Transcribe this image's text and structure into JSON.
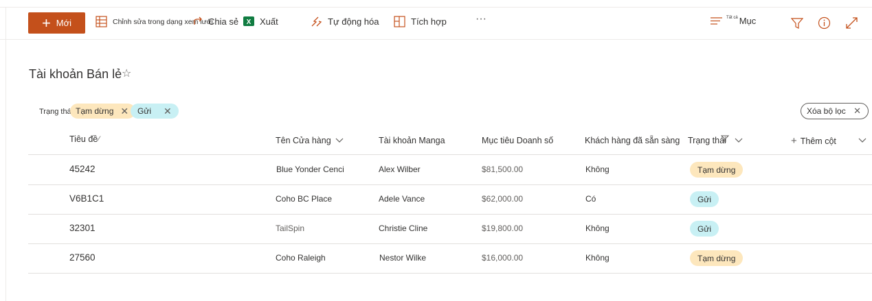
{
  "toolbar": {
    "new_label": "Mới",
    "edit_grid_label": "Chỉnh sửa trong dạng xem lưới",
    "share_label": "Chia sẻ",
    "export_label": "Xuất",
    "automate_label": "Tự động hóa",
    "integrate_label": "Tích hợp",
    "more_label": "···",
    "view_small": "Tất cả",
    "view_label": "Mục"
  },
  "page": {
    "title": "Tài khoản Bán lẻ"
  },
  "filters": {
    "label": "Trạng thái:",
    "pills": [
      {
        "label": "Tạm dừng",
        "color": "#fde7bd"
      },
      {
        "label": "Gửi",
        "color": "#c8f0f4"
      }
    ],
    "clear_label": "Xóa bộ lọc"
  },
  "columns": {
    "title": "Tiêu đề",
    "store": "Tên Cửa hàng",
    "manager": "Tài khoản Manga",
    "target": "Mục tiêu Doanh số",
    "ready": "Khách hàng đã sẵn sàng",
    "status": "Trạng thái",
    "add": "Thêm cột"
  },
  "rows": [
    {
      "title": "45242",
      "store": "Blue Yonder Cenci",
      "manager": "Alex Wilber",
      "target": "$81,500.00",
      "ready": "Không",
      "status": "Tạm dừng"
    },
    {
      "title": "V6B1C1",
      "store": "Coho BC Place",
      "manager": "Adele Vance",
      "target": "$62,000.00",
      "ready": "Có",
      "status": "Gửi"
    },
    {
      "title": "32301",
      "store": "TailSpin",
      "manager": "Christie Cline",
      "target": "$19,800.00",
      "ready": "Không",
      "status": "Gửi"
    },
    {
      "title": "27560",
      "store": "Coho Raleigh",
      "manager": "Nestor Wilke",
      "target": "$16,000.00",
      "ready": "Không",
      "status": "Tạm dừng"
    }
  ],
  "colors": {
    "accent": "#c4501b",
    "paused": "#fde7bd",
    "sent": "#c8f0f4",
    "excel": "#107c41"
  }
}
